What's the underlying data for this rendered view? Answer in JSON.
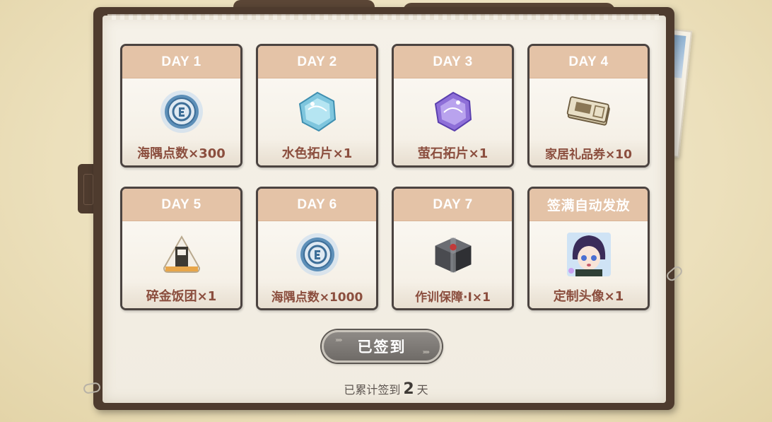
{
  "cards": [
    {
      "day": "DAY 1",
      "reward": "海隅点数×300",
      "icon": "coin-icon"
    },
    {
      "day": "DAY 2",
      "reward": "水色拓片×1",
      "icon": "blue-tile-icon"
    },
    {
      "day": "DAY 3",
      "reward": "萤石拓片×1",
      "icon": "purple-tile-icon"
    },
    {
      "day": "DAY 4",
      "reward": "家居礼品券×10",
      "icon": "ticket-icon"
    },
    {
      "day": "DAY 5",
      "reward": "碎金饭团×1",
      "icon": "rice-ball-icon"
    },
    {
      "day": "DAY 6",
      "reward": "海隅点数×1000",
      "icon": "coin-icon"
    },
    {
      "day": "DAY 7",
      "reward": "作训保障·Ⅰ×1",
      "icon": "supply-box-icon"
    },
    {
      "day": "签满自动发放",
      "reward": "定制头像×1",
      "icon": "avatar-icon"
    }
  ],
  "sign_button": {
    "label": "已签到"
  },
  "cumulative": {
    "prefix": "已累计签到",
    "count": "2",
    "suffix": "天"
  },
  "colors": {
    "card_header": "#e4c3a7",
    "reward_text": "#8b4e3e",
    "book_cover": "#4e3b2e",
    "button_gray": "#7c7874"
  }
}
